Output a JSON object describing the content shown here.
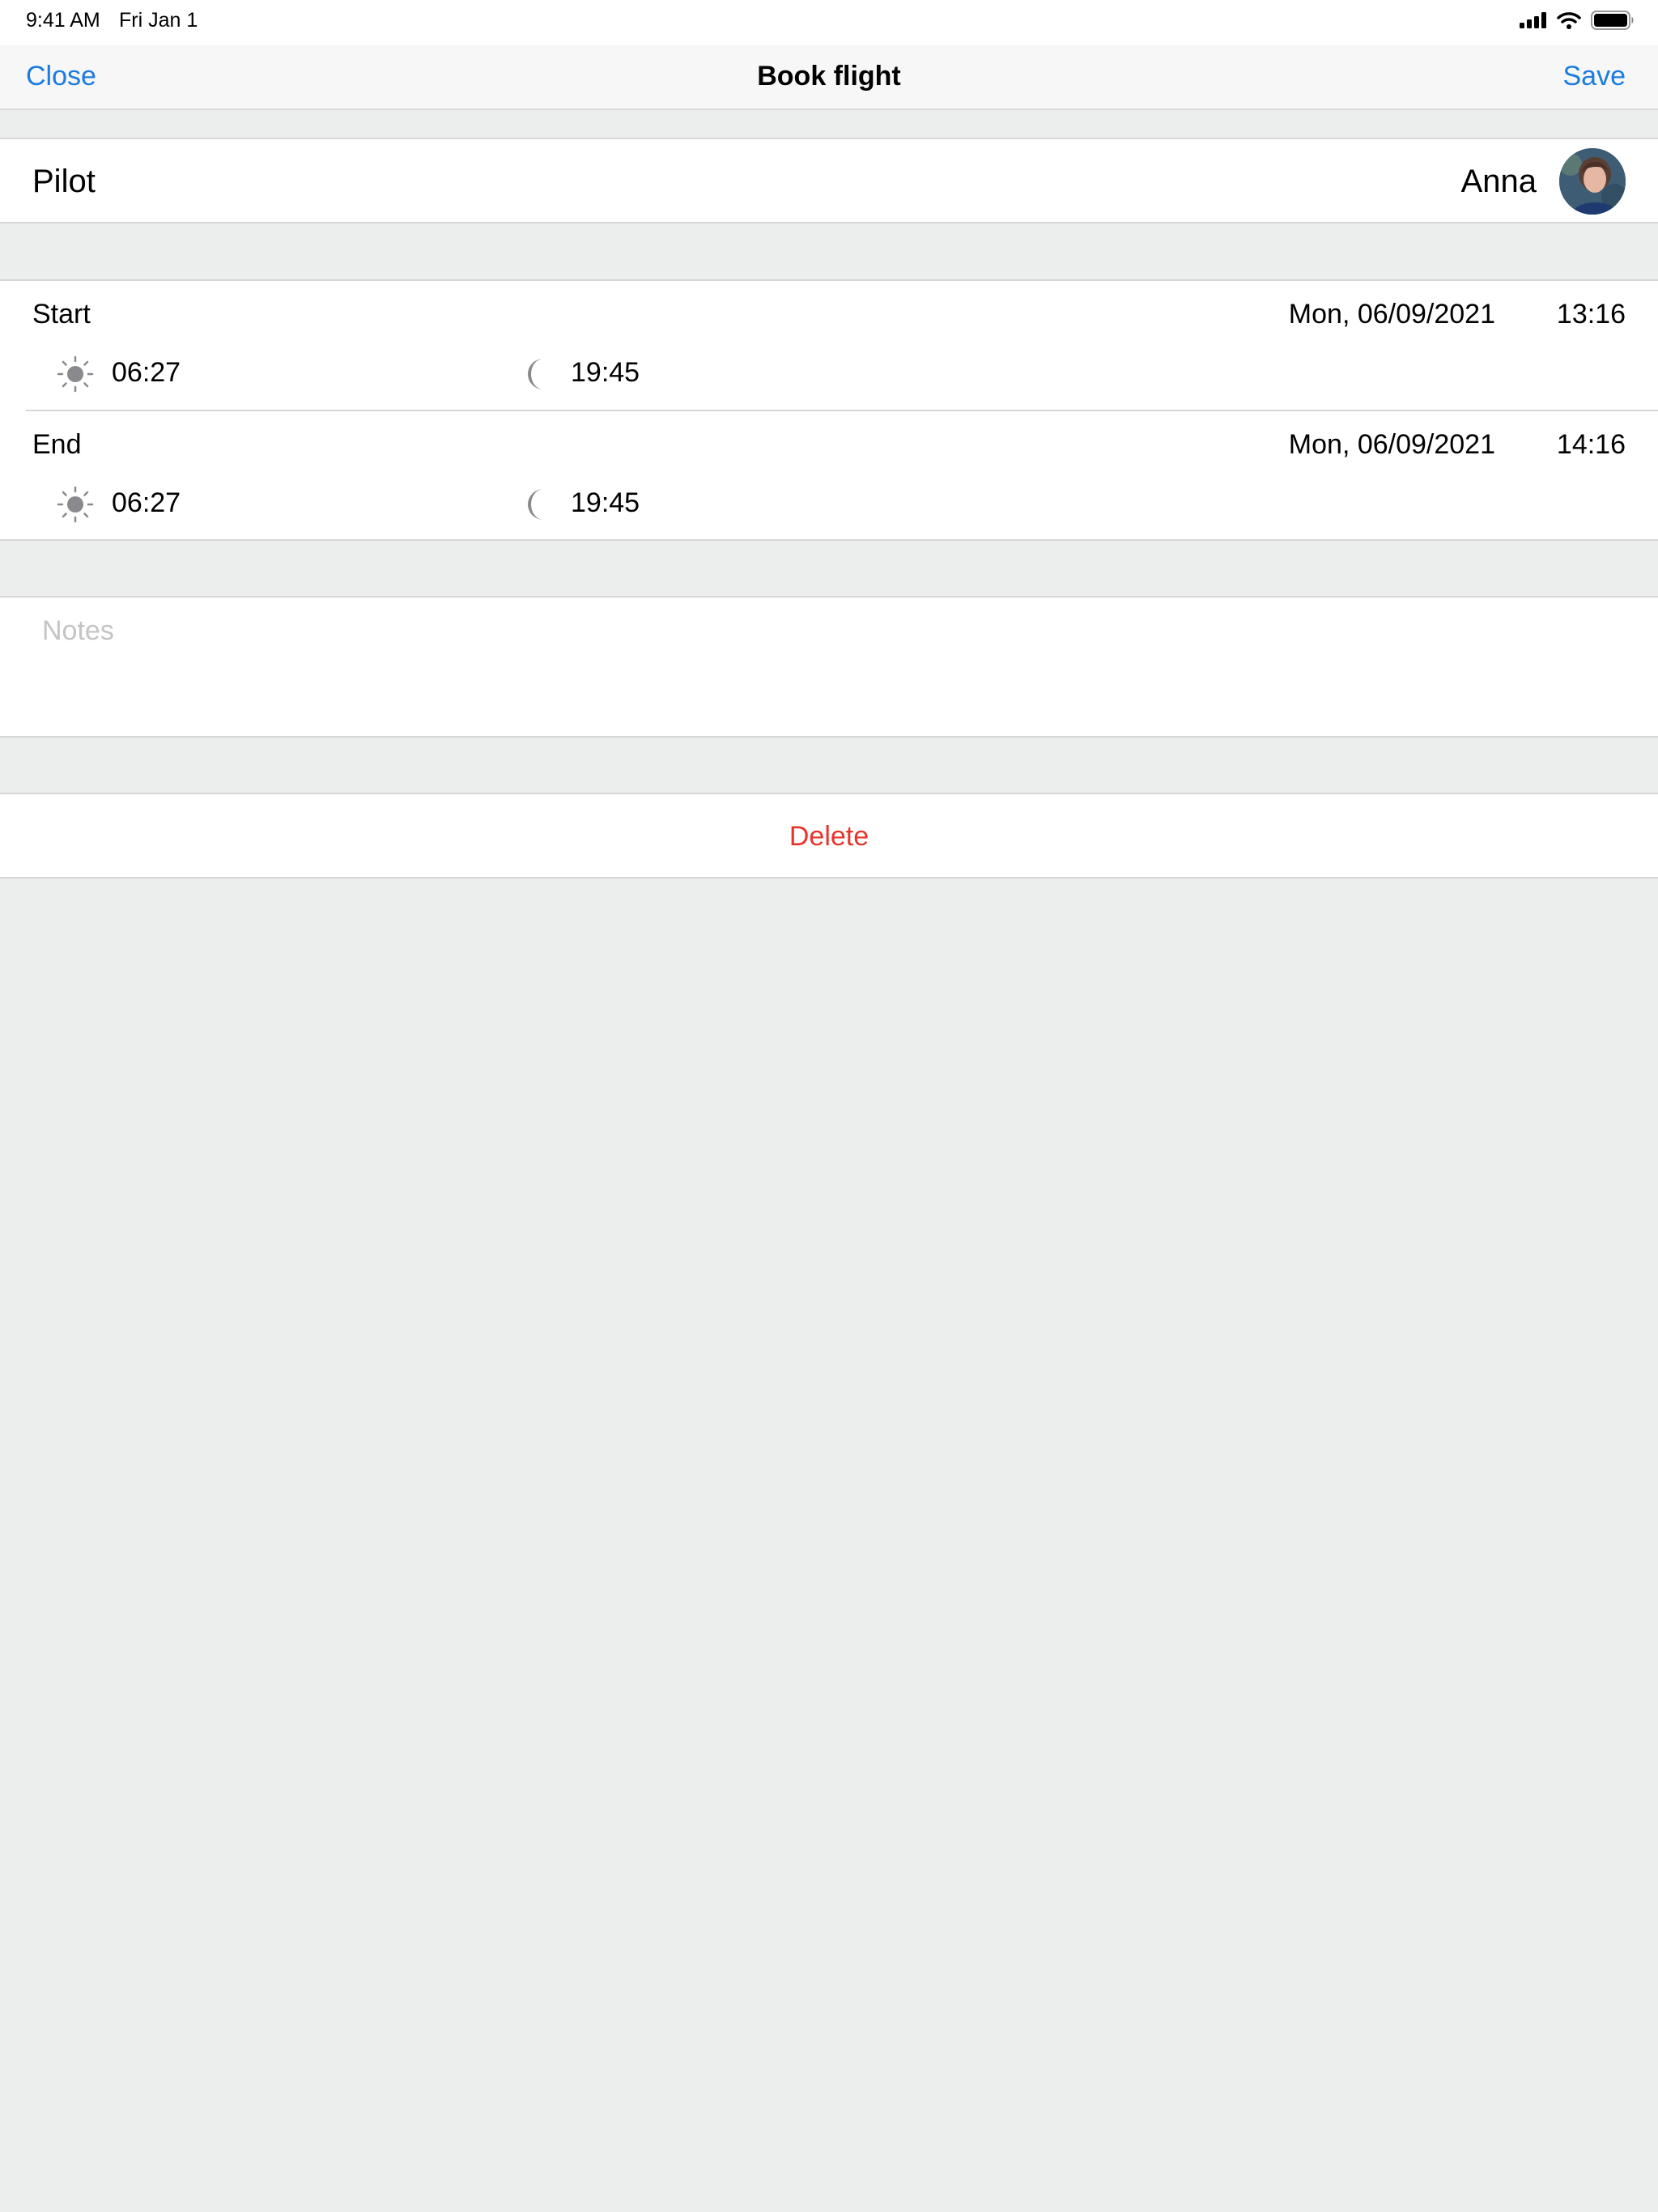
{
  "status_bar": {
    "time": "9:41 AM",
    "date": "Fri Jan 1",
    "icons": [
      "cellular-signal-icon",
      "wifi-icon",
      "battery-icon"
    ]
  },
  "nav": {
    "close_label": "Close",
    "title": "Book flight",
    "save_label": "Save"
  },
  "pilot": {
    "label": "Pilot",
    "name": "Anna"
  },
  "start": {
    "label": "Start",
    "date": "Mon, 06/09/2021",
    "time": "13:16",
    "sunrise": "06:27",
    "sunset": "19:45"
  },
  "end": {
    "label": "End",
    "date": "Mon, 06/09/2021",
    "time": "14:16",
    "sunrise": "06:27",
    "sunset": "19:45"
  },
  "notes": {
    "placeholder": "Notes",
    "value": ""
  },
  "delete_label": "Delete",
  "colors": {
    "accent": "#1B7BE0",
    "destructive": "#E8352C",
    "background": "#ECEDED",
    "icon_gray": "#8A8A8E"
  }
}
